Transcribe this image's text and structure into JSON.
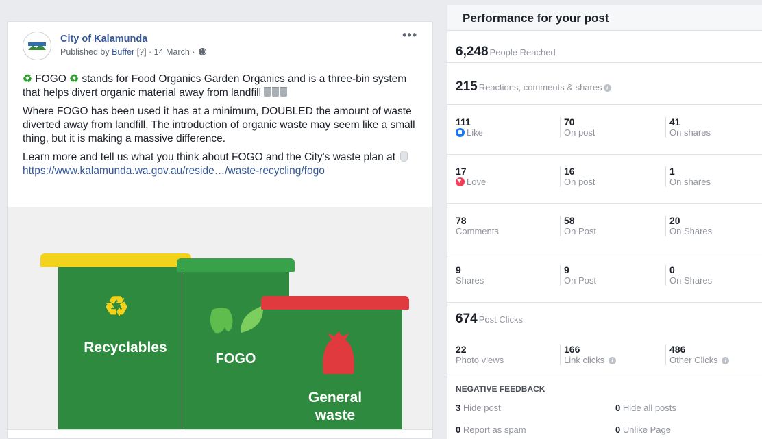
{
  "post": {
    "page_name": "City of Kalamunda",
    "avatar_text": "City of Kalamunda",
    "published_by_prefix": "Published by ",
    "publisher": "Buffer",
    "help_marker": " [?] · ",
    "date": "14 March · ",
    "more_label": "•••",
    "p1_a": " FOGO ",
    "p1_b": " stands for Food Organics Garden Organics and is a three-bin system that helps divert organic material away from landfill ",
    "recycle_symbol": "♻",
    "p2": "Where FOGO has been used it has at a minimum, DOUBLED the amount of waste diverted away from landfill. The introduction of organic waste may seem like a small thing, but it is making a massive difference.",
    "p3": "Learn more and tell us what you think about FOGO and the City's waste plan at ",
    "url": "https://www.kalamunda.wa.gov.au/reside…/waste-recycling/fogo",
    "image": {
      "bin1_label": "Recyclables",
      "bin2_label": "FOGO",
      "bin3_label_line1": "General",
      "bin3_label_line2": "waste",
      "colors": {
        "bin_green": "#2d8a3e",
        "lid_yellow": "#f2d21b",
        "lid_green": "#37a24a",
        "lid_red": "#e0393e"
      }
    }
  },
  "panel": {
    "title": "Performance for your post",
    "reached_value": "6,248",
    "reached_label": "People Reached",
    "reactions_value": "215",
    "reactions_label": "Reactions, comments & shares",
    "rows": [
      {
        "c1_num": "111",
        "c1_lbl": "Like",
        "c2_num": "70",
        "c2_lbl": "On post",
        "c3_num": "41",
        "c3_lbl": "On shares"
      },
      {
        "c1_num": "17",
        "c1_lbl": "Love",
        "c2_num": "16",
        "c2_lbl": "On post",
        "c3_num": "1",
        "c3_lbl": "On shares"
      },
      {
        "c1_num": "78",
        "c1_lbl": "Comments",
        "c2_num": "58",
        "c2_lbl": "On Post",
        "c3_num": "20",
        "c3_lbl": "On Shares"
      },
      {
        "c1_num": "9",
        "c1_lbl": "Shares",
        "c2_num": "9",
        "c2_lbl": "On Post",
        "c3_num": "0",
        "c3_lbl": "On Shares"
      }
    ],
    "clicks_value": "674",
    "clicks_label": "Post Clicks",
    "clicks": [
      {
        "num": "22",
        "lbl": "Photo views"
      },
      {
        "num": "166",
        "lbl": "Link clicks"
      },
      {
        "num": "486",
        "lbl": "Other Clicks"
      }
    ],
    "negative_title": "Negative Feedback",
    "negative": [
      {
        "num": "3",
        "lbl": "Hide post"
      },
      {
        "num": "0",
        "lbl": "Hide all posts"
      },
      {
        "num": "0",
        "lbl": "Report as spam"
      },
      {
        "num": "0",
        "lbl": "Unlike Page"
      }
    ],
    "info_glyph": "i"
  }
}
